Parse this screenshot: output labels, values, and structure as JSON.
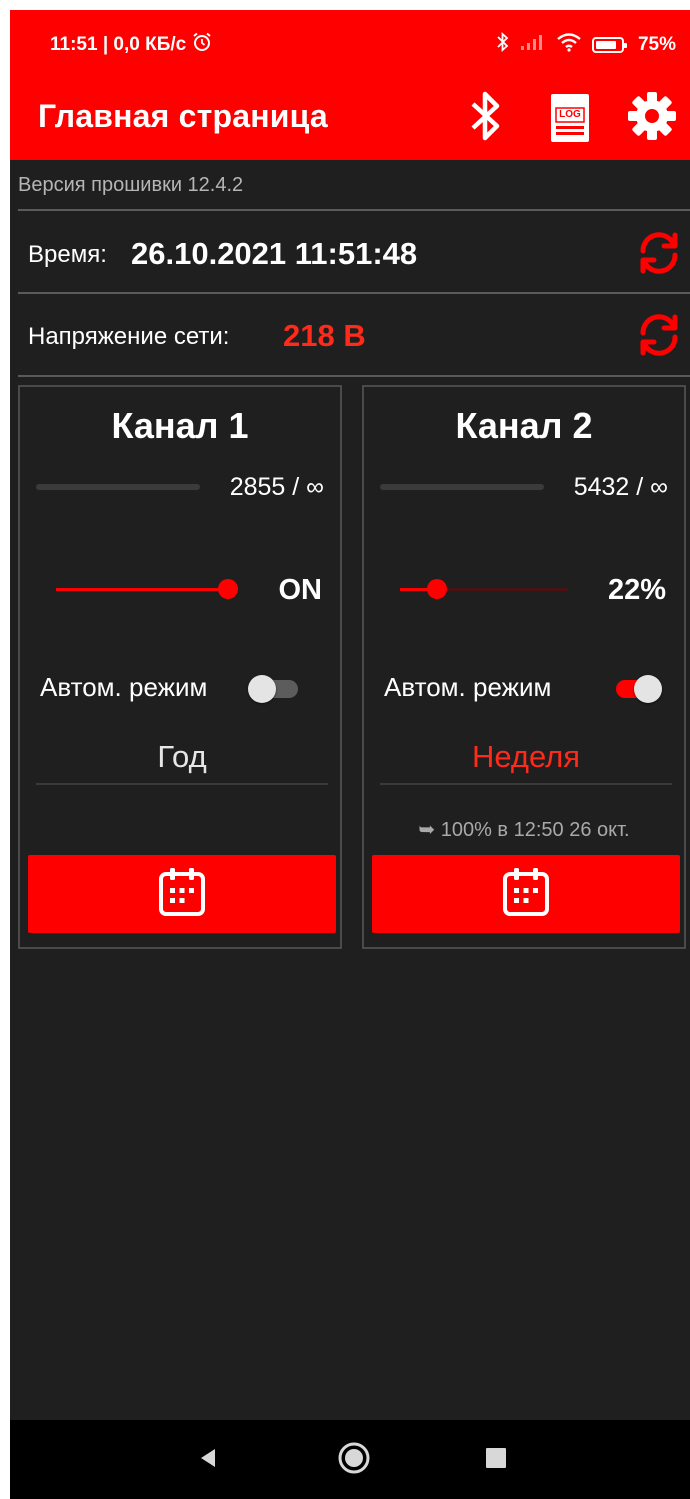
{
  "status_bar": {
    "time_info": "11:51 | 0,0 КБ/с",
    "battery": "75%"
  },
  "app_bar": {
    "title": "Главная страница",
    "icons": [
      "bluetooth-icon",
      "log-icon",
      "gear-icon"
    ],
    "log_icon_text": "LOG"
  },
  "firmware": "Версия прошивки 12.4.2",
  "time_row": {
    "label": "Время:",
    "value": "26.10.2021 11:51:48"
  },
  "voltage_row": {
    "label": "Напряжение сети:",
    "value": "218 В"
  },
  "channels": [
    {
      "title": "Канал 1",
      "counter": "2855 / ∞",
      "slider_level": 1.0,
      "slider_value": "ON",
      "auto_label": "Автом. режим",
      "auto_enabled": false,
      "mode": "Год",
      "next_info": ""
    },
    {
      "title": "Канал 2",
      "counter": "5432 / ∞",
      "slider_level": 0.22,
      "slider_value": "22%",
      "auto_label": "Автом. режим",
      "auto_enabled": true,
      "mode": "Неделя",
      "next_info": "➥ 100% в 12:50 26 окт."
    }
  ],
  "colors": {
    "accent": "#fe0000",
    "background": "#1f1f1f",
    "secondary_text": "#a9a9a9"
  }
}
